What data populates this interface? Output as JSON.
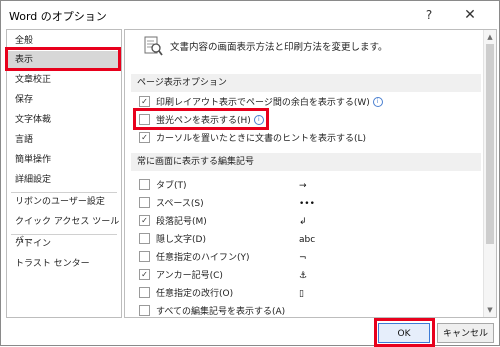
{
  "window": {
    "title": "Word のオプション",
    "help": "?",
    "close": "✕"
  },
  "sidebar": {
    "items": [
      {
        "label": "全般"
      },
      {
        "label": "表示"
      },
      {
        "label": "文章校正"
      },
      {
        "label": "保存"
      },
      {
        "label": "文字体裁"
      },
      {
        "label": "言語"
      },
      {
        "label": "簡単操作"
      },
      {
        "label": "詳細設定"
      },
      {
        "label": "リボンのユーザー設定"
      },
      {
        "label": "クイック アクセス ツール バー"
      },
      {
        "label": "アドイン"
      },
      {
        "label": "トラスト センター"
      }
    ],
    "selected": "表示"
  },
  "content": {
    "header": "文書内容の画面表示方法と印刷方法を変更します。",
    "page_display": {
      "title": "ページ表示オプション",
      "options": [
        {
          "label": "印刷レイアウト表示でページ間の余白を表示する(W)",
          "checked": true,
          "info": true
        },
        {
          "label": "蛍光ペンを表示する(H)",
          "checked": false,
          "info": true
        },
        {
          "label": "カーソルを置いたときに文書のヒントを表示する(L)",
          "checked": true,
          "info": false
        }
      ]
    },
    "formatting_marks": {
      "title": "常に画面に表示する編集記号",
      "options": [
        {
          "label": "タブ(T)",
          "checked": false,
          "symbol": "→"
        },
        {
          "label": "スペース(S)",
          "checked": false,
          "symbol": "•••"
        },
        {
          "label": "段落記号(M)",
          "checked": true,
          "symbol": "↲"
        },
        {
          "label": "隠し文字(D)",
          "checked": false,
          "symbol": "abc"
        },
        {
          "label": "任意指定のハイフン(Y)",
          "checked": false,
          "symbol": "¬"
        },
        {
          "label": "アンカー記号(C)",
          "checked": true,
          "symbol": "⚓"
        },
        {
          "label": "任意指定の改行(O)",
          "checked": false,
          "symbol": "▯"
        },
        {
          "label": "すべての編集記号を表示する(A)",
          "checked": false,
          "symbol": ""
        }
      ]
    }
  },
  "footer": {
    "ok": "OK",
    "cancel": "キャンセル"
  },
  "colors": {
    "highlight": "#e8001c",
    "selected_bg": "#d7d7d7",
    "section_bg": "#f0f0f0"
  }
}
